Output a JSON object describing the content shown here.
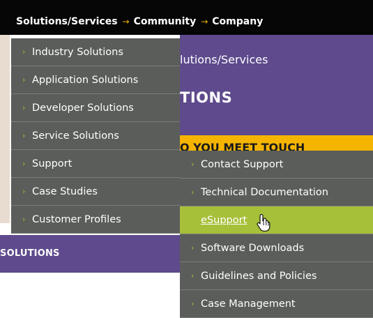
{
  "topnav": {
    "items": [
      "Solutions/Services",
      "Community",
      "Company"
    ],
    "separator": "→"
  },
  "hero": {
    "breadcrumb": "lutions/Services",
    "title": "TIONS",
    "banner": "O YOU MEET TOUCH"
  },
  "section": {
    "label": "SOLUTIONS"
  },
  "menu_primary": {
    "items": [
      "Industry Solutions",
      "Application Solutions",
      "Developer Solutions",
      "Service Solutions",
      "Support",
      "Case Studies",
      "Customer Profiles"
    ]
  },
  "menu_support": {
    "items": [
      "Contact Support",
      "Technical Documentation",
      "eSupport",
      "Software Downloads",
      "Guidelines and Policies",
      "Case Management"
    ],
    "active": "eSupport"
  },
  "icons": {
    "chevron": "›",
    "cursor": "hand-pointer-icon"
  },
  "colors": {
    "purple": "#5e4a8c",
    "gray": "#5a5d5a",
    "green": "#a6c03a",
    "yellow": "#f5b400"
  }
}
